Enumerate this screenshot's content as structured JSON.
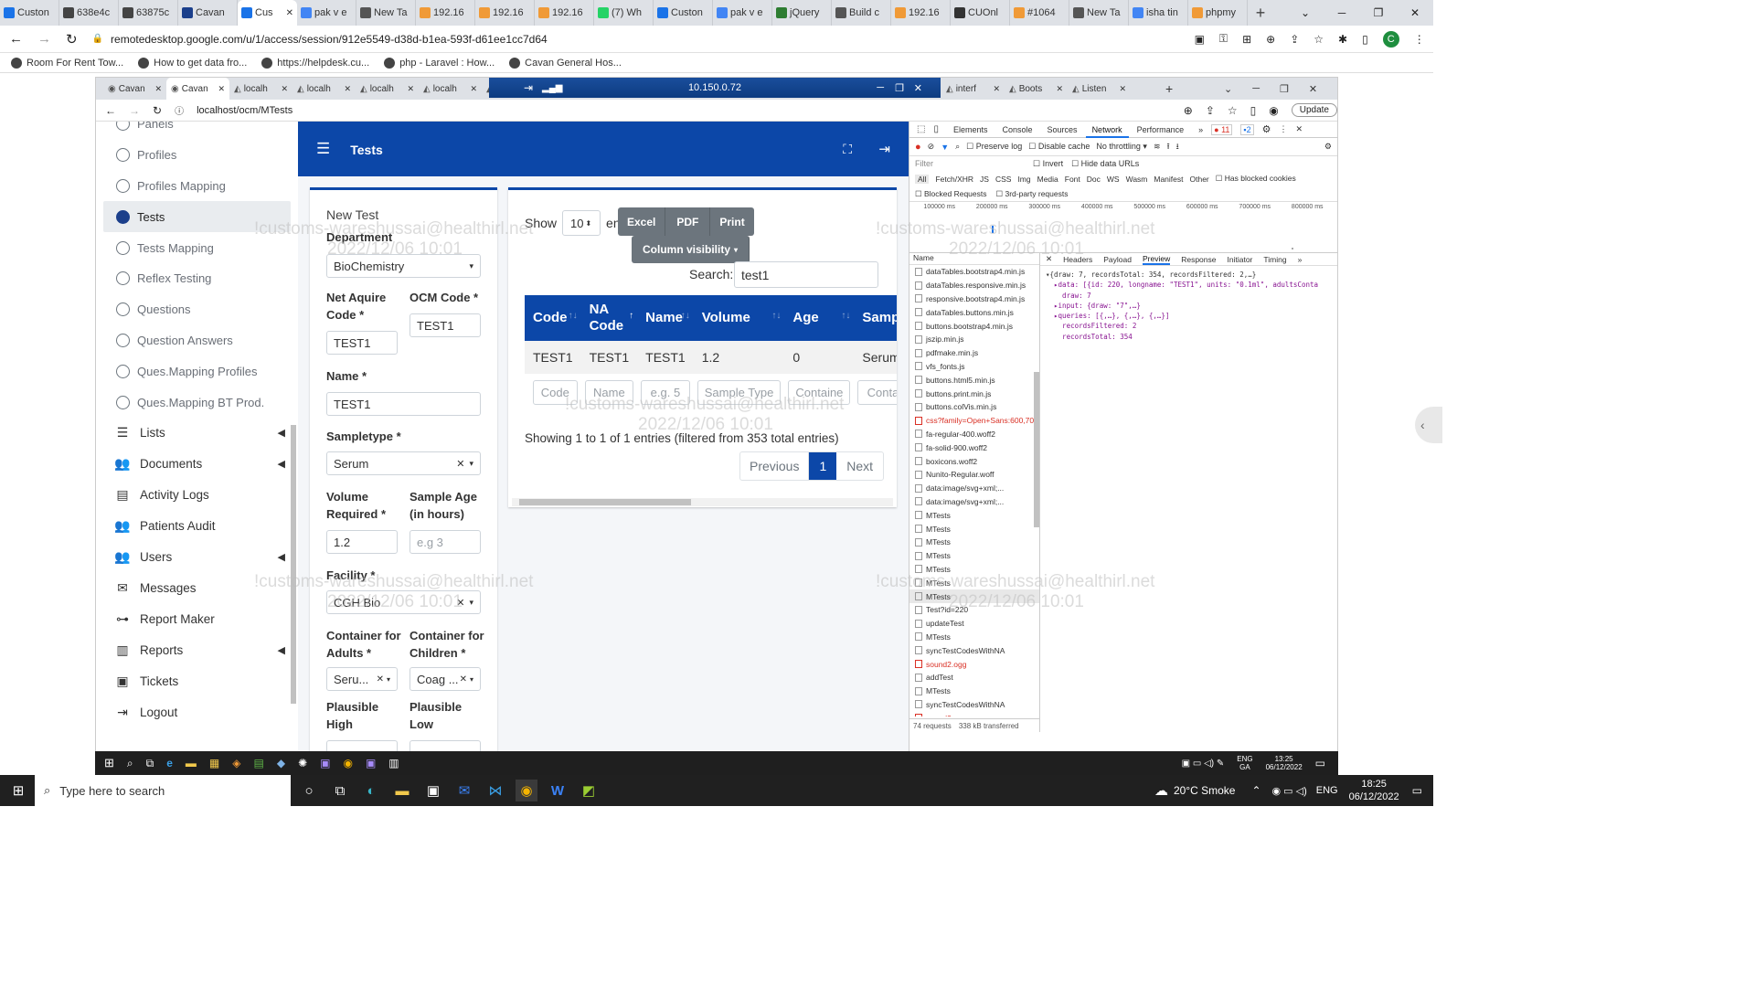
{
  "outer_browser": {
    "tabs": [
      "Custon",
      "638e4c",
      "63875c",
      "Cavan",
      "Cus",
      "pak v e",
      "New Ta",
      "192.16",
      "192.16",
      "192.16",
      "(7) Wh",
      "Custon",
      "pak v e",
      "jQuery",
      "Build c",
      "192.16",
      "CUOnl",
      "#1064",
      "New Ta",
      "isha tin",
      "phpmy"
    ],
    "address": "remotedesktop.google.com/u/1/access/session/912e5549-d38d-b1ea-593f-d61ee1cc7d64",
    "bookmarks": [
      "Room For Rent Tow...",
      "How to get data fro...",
      "https://helpdesk.cu...",
      "php - Laravel : How...",
      "Cavan General Hos..."
    ],
    "profile_initial": "C"
  },
  "remote": {
    "ip": "10.150.0.72",
    "inner_tabs": [
      "Cavan",
      "Cavan",
      "localh",
      "localh",
      "localh",
      "localh",
      "localh",
      "interf",
      "Boots",
      "Listen"
    ],
    "address": "localhost/ocm/MTests",
    "update_label": "Update"
  },
  "sidebar": {
    "sub_items": [
      {
        "label": "Panels",
        "active": false
      },
      {
        "label": "Profiles",
        "active": false
      },
      {
        "label": "Profiles Mapping",
        "active": false
      },
      {
        "label": "Tests",
        "active": true
      },
      {
        "label": "Tests Mapping",
        "active": false
      },
      {
        "label": "Reflex Testing",
        "active": false
      },
      {
        "label": "Questions",
        "active": false
      },
      {
        "label": "Question Answers",
        "active": false
      },
      {
        "label": "Ques.Mapping Profiles",
        "active": false
      },
      {
        "label": "Ques.Mapping BT Prod.",
        "active": false
      }
    ],
    "main_items": [
      {
        "label": "Lists",
        "icon": "list-icon",
        "chevron": true
      },
      {
        "label": "Documents",
        "icon": "users-icon",
        "chevron": true
      },
      {
        "label": "Activity Logs",
        "icon": "register-icon",
        "chevron": false
      },
      {
        "label": "Patients Audit",
        "icon": "users-icon",
        "chevron": false
      },
      {
        "label": "Users",
        "icon": "users-icon",
        "chevron": true
      },
      {
        "label": "Messages",
        "icon": "envelope-icon",
        "chevron": false
      },
      {
        "label": "Report Maker",
        "icon": "sitemap-icon",
        "chevron": false
      },
      {
        "label": "Reports",
        "icon": "chart-icon",
        "chevron": true
      },
      {
        "label": "Tickets",
        "icon": "ticket-icon",
        "chevron": false
      },
      {
        "label": "Logout",
        "icon": "logout-icon",
        "chevron": false
      }
    ]
  },
  "header": {
    "title": "Tests"
  },
  "form": {
    "title": "New Test",
    "department_label": "Department",
    "department_value": "BioChemistry",
    "net_code_label": "Net Aquire Code *",
    "net_code_value": "TEST1",
    "ocm_code_label": "OCM Code *",
    "ocm_code_value": "TEST1",
    "name_label": "Name *",
    "name_value": "TEST1",
    "sampletype_label": "Sampletype *",
    "sampletype_value": "Serum",
    "volume_label": "Volume Required *",
    "volume_value": "1.2",
    "age_label": "Sample Age (in hours)",
    "age_placeholder": "e.g 3",
    "facility_label": "Facility *",
    "facility_value": "CGH Bio",
    "container_adults_label": "Container for Adults *",
    "container_adults_value": "Seru...",
    "container_children_label": "Container for Children *",
    "container_children_value": "Coag ...",
    "plausible_high_label": "Plausible High",
    "plausible_low_label": "Plausible Low"
  },
  "table": {
    "show_label": "Show",
    "show_value": "10",
    "entries_label": "entries",
    "buttons": [
      "Excel",
      "PDF",
      "Print"
    ],
    "column_visibility": "Column visibility",
    "search_label": "Search:",
    "search_value": "test1",
    "columns": [
      "Code",
      "NA Code",
      "Name",
      "Volume",
      "Age",
      "SampleT"
    ],
    "rows": [
      [
        "TEST1",
        "TEST1",
        "TEST1",
        "1.2",
        "0",
        "Serum"
      ]
    ],
    "filters": [
      "Code",
      "Name",
      "e.g. 5",
      "Sample Type",
      "Containe",
      "Containe"
    ],
    "info": "Showing 1 to 1 of 1 entries (filtered from 353 total entries)",
    "pagination": {
      "previous": "Previous",
      "current": "1",
      "next": "Next"
    }
  },
  "devtools": {
    "tabs": [
      "Elements",
      "Console",
      "Sources",
      "Network",
      "Performance"
    ],
    "active_tab": "Network",
    "error_count": "11",
    "message_count": "2",
    "preserve_log": "Preserve log",
    "disable_cache": "Disable cache",
    "throttling": "No throttling",
    "filter_placeholder": "Filter",
    "invert": "Invert",
    "hide_data_urls": "Hide data URLs",
    "type_filters": [
      "All",
      "Fetch/XHR",
      "JS",
      "CSS",
      "Img",
      "Media",
      "Font",
      "Doc",
      "WS",
      "Wasm",
      "Manifest",
      "Other"
    ],
    "has_blocked_cookies": "Has blocked cookies",
    "blocked_requests": "Blocked Requests",
    "third_party": "3rd-party requests",
    "timeline_ticks": [
      "100000 ms",
      "200000 ms",
      "300000 ms",
      "400000 ms",
      "500000 ms",
      "600000 ms",
      "700000 ms",
      "800000 ms"
    ],
    "name_header": "Name",
    "requests": [
      {
        "name": "dataTables.bootstrap4.min.js",
        "err": false
      },
      {
        "name": "dataTables.responsive.min.js",
        "err": false
      },
      {
        "name": "responsive.bootstrap4.min.js",
        "err": false
      },
      {
        "name": "dataTables.buttons.min.js",
        "err": false
      },
      {
        "name": "buttons.bootstrap4.min.js",
        "err": false
      },
      {
        "name": "jszip.min.js",
        "err": false
      },
      {
        "name": "pdfmake.min.js",
        "err": false
      },
      {
        "name": "vfs_fonts.js",
        "err": false
      },
      {
        "name": "buttons.html5.min.js",
        "err": false
      },
      {
        "name": "buttons.print.min.js",
        "err": false
      },
      {
        "name": "buttons.colVis.min.js",
        "err": false
      },
      {
        "name": "css?family=Open+Sans:600,700",
        "err": true
      },
      {
        "name": "fa-regular-400.woff2",
        "err": false
      },
      {
        "name": "fa-solid-900.woff2",
        "err": false
      },
      {
        "name": "boxicons.woff2",
        "err": false
      },
      {
        "name": "Nunito-Regular.woff",
        "err": false
      },
      {
        "name": "data:image/svg+xml;...",
        "err": false
      },
      {
        "name": "data:image/svg+xml;...",
        "err": false
      },
      {
        "name": "MTests",
        "err": false
      },
      {
        "name": "MTests",
        "err": false
      },
      {
        "name": "MTests",
        "err": false
      },
      {
        "name": "MTests",
        "err": false
      },
      {
        "name": "MTests",
        "err": false
      },
      {
        "name": "MTests",
        "err": false
      },
      {
        "name": "MTests",
        "err": false
      },
      {
        "name": "Test?id=220",
        "err": false
      },
      {
        "name": "updateTest",
        "err": false
      },
      {
        "name": "MTests",
        "err": false
      },
      {
        "name": "syncTestCodesWithNA",
        "err": false
      },
      {
        "name": "sound2.ogg",
        "err": true
      },
      {
        "name": "addTest",
        "err": false
      },
      {
        "name": "MTests",
        "err": false
      },
      {
        "name": "syncTestCodesWithNA",
        "err": false
      },
      {
        "name": "sound2.ogg",
        "err": true
      }
    ],
    "detail_tabs": [
      "Headers",
      "Payload",
      "Preview",
      "Response",
      "Initiator",
      "Timing"
    ],
    "active_detail": "Preview",
    "preview_lines": [
      "▾{draw: 7, recordsTotal: 354, recordsFiltered: 2,…}",
      "  ▸data: [{id: 220, longname: \"TEST1\", units: \"0.1ml\", adultsConta",
      "    draw: 7",
      "  ▸input: {draw: \"7\",…}",
      "  ▸queries: [{,…}, {,…}, {,…}]",
      "    recordsFiltered: 2",
      "    recordsTotal: 354"
    ],
    "status_requests": "74 requests",
    "status_transferred": "338 kB transferred"
  },
  "watermarks": {
    "user": "!customs-wareshussai@healthirl.net",
    "time": "2022/12/06 10:01"
  },
  "inner_taskbar": {
    "lang": "ENG",
    "region": "GA",
    "time": "13:25",
    "date": "06/12/2022"
  },
  "taskbar": {
    "search_placeholder": "Type here to search",
    "weather": "20°C  Smoke",
    "lang": "ENG",
    "time": "18:25",
    "date": "06/12/2022"
  },
  "colors": {
    "brand_blue": "#0c47a8",
    "sidebar_active": "#1b3f8b",
    "error_red": "#d93025"
  }
}
